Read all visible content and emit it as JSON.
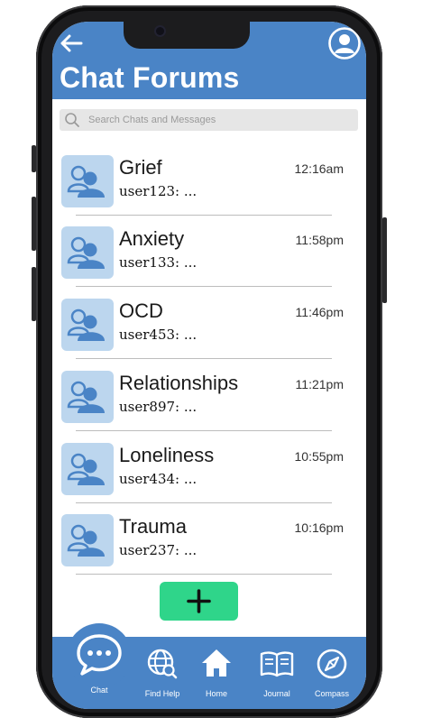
{
  "header": {
    "title": "Chat Forums",
    "back_icon": "arrow-left-icon",
    "profile_icon": "user-circle-icon"
  },
  "search": {
    "placeholder": "Search Chats and Messages",
    "icon": "search-icon"
  },
  "forums": [
    {
      "name": "Grief",
      "preview": "user123: ...",
      "time": "12:16am"
    },
    {
      "name": "Anxiety",
      "preview": "user133: ...",
      "time": "11:58pm"
    },
    {
      "name": "OCD",
      "preview": "user453: ...",
      "time": "11:46pm"
    },
    {
      "name": "Relationships",
      "preview": "user897: ...",
      "time": "11:21pm"
    },
    {
      "name": "Loneliness",
      "preview": "user434: ...",
      "time": "10:55pm"
    },
    {
      "name": "Trauma",
      "preview": "user237: ...",
      "time": "10:16pm"
    }
  ],
  "add_button": {
    "icon": "plus-icon"
  },
  "nav": {
    "items": [
      {
        "label": "Chat",
        "icon": "chat-bubble-icon"
      },
      {
        "label": "Find Help",
        "icon": "globe-search-icon"
      },
      {
        "label": "Home",
        "icon": "home-icon"
      },
      {
        "label": "Journal",
        "icon": "book-icon"
      },
      {
        "label": "Compass",
        "icon": "compass-icon"
      }
    ]
  },
  "colors": {
    "header": "#4a84c6",
    "nav": "#4a84c6",
    "avatar_bg": "#bcd6ee",
    "avatar_fg": "#4a84c6",
    "add_button": "#2fd58a"
  }
}
